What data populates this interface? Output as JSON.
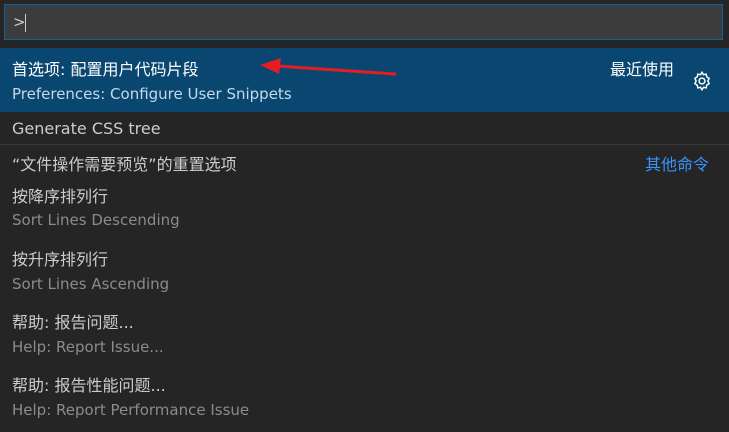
{
  "input": {
    "value": ">"
  },
  "items": [
    {
      "label": "首选项: 配置用户代码片段",
      "detail": "Preferences: Configure User Snippets",
      "meta": "最近使用"
    },
    {
      "label": "Generate CSS tree"
    },
    {
      "label": "“文件操作需要预览”的重置选项",
      "meta": "其他命令"
    },
    {
      "label": "按降序排列行",
      "detail": "Sort Lines Descending"
    },
    {
      "label": "按升序排列行",
      "detail": "Sort Lines Ascending"
    },
    {
      "label": "帮助: 报告问题...",
      "detail": "Help: Report Issue..."
    },
    {
      "label": "帮助: 报告性能问题...",
      "detail": "Help: Report Performance Issue"
    }
  ],
  "icons": {
    "gear": "gear-icon",
    "arrow": "red-arrow-annotation"
  },
  "colors": {
    "background": "#252526",
    "selection": "#094771",
    "input_border": "#0e639c",
    "link": "#3794ff",
    "annotation": "#e51c23"
  }
}
